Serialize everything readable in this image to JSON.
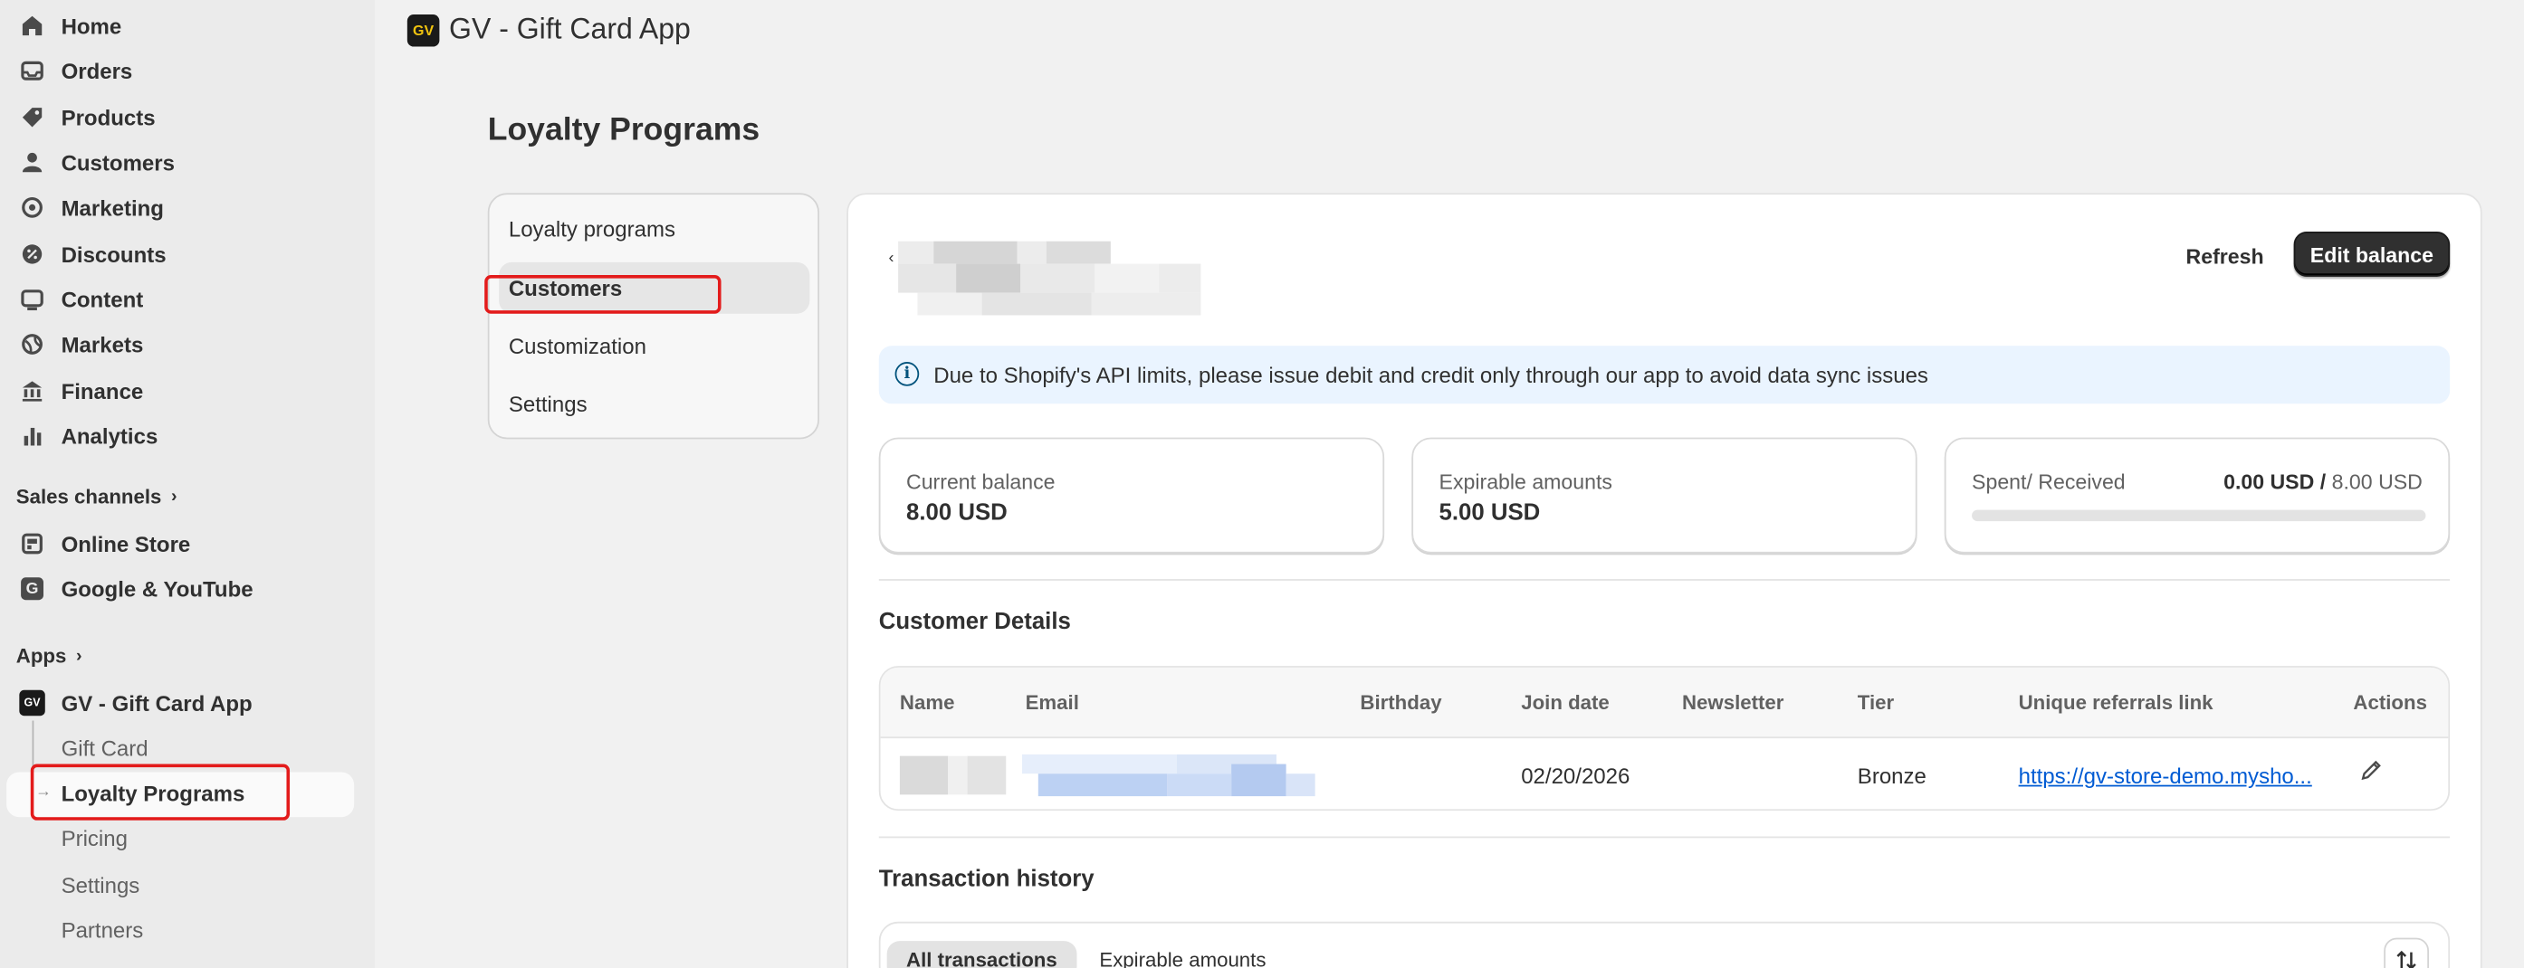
{
  "sidebar": {
    "items": [
      {
        "label": "Home",
        "icon": "home-icon"
      },
      {
        "label": "Orders",
        "icon": "inbox-icon"
      },
      {
        "label": "Products",
        "icon": "tag-icon"
      },
      {
        "label": "Customers",
        "icon": "person-icon"
      },
      {
        "label": "Marketing",
        "icon": "target-icon"
      },
      {
        "label": "Discounts",
        "icon": "discount-icon"
      },
      {
        "label": "Content",
        "icon": "content-icon"
      },
      {
        "label": "Markets",
        "icon": "globe-icon"
      },
      {
        "label": "Finance",
        "icon": "bank-icon"
      },
      {
        "label": "Analytics",
        "icon": "bar-chart-icon"
      }
    ],
    "sales_channels_label": "Sales channels",
    "channels": [
      {
        "label": "Online Store",
        "icon": "store-icon"
      },
      {
        "label": "Google & YouTube",
        "icon": "google-icon"
      }
    ],
    "apps_label": "Apps",
    "app": {
      "label": "GV - Gift Card App",
      "logo": "GV"
    },
    "app_subitems": [
      "Gift Card",
      "Loyalty Programs",
      "Pricing",
      "Settings",
      "Partners"
    ]
  },
  "header": {
    "app_title": "GV - Gift Card App",
    "logo_text": "GV"
  },
  "page": {
    "title": "Loyalty Programs"
  },
  "menu": {
    "items": [
      "Loyalty programs",
      "Customers",
      "Customization",
      "Settings"
    ],
    "selected": "Customers"
  },
  "actions": {
    "refresh": "Refresh",
    "edit_balance": "Edit balance"
  },
  "banner": {
    "text": "Due to Shopify's API limits, please issue debit and credit only through our app to avoid data sync issues",
    "icon": "info-icon"
  },
  "stats": {
    "current_balance": {
      "label": "Current balance",
      "value": "8.00 USD"
    },
    "expirable": {
      "label": "Expirable amounts",
      "value": "5.00 USD"
    },
    "spent_received": {
      "label": "Spent/ Received",
      "spent": "0.00 USD",
      "separator": "/",
      "received": "8.00 USD",
      "progress": 0
    }
  },
  "customer_details": {
    "title": "Customer Details",
    "columns": [
      "Name",
      "Email",
      "Birthday",
      "Join date",
      "Newsletter",
      "Tier",
      "Unique referrals link",
      "Actions"
    ],
    "row": {
      "birthday": "",
      "join_date": "02/20/2026",
      "newsletter": "",
      "tier": "Bronze",
      "referral_link": "https://gv-store-demo.mysho..."
    }
  },
  "transactions": {
    "title": "Transaction history",
    "tabs": [
      "All transactions",
      "Expirable amounts"
    ]
  },
  "colors": {
    "highlight": "#e31b1b",
    "primary_button": "#303030",
    "banner_bg": "#eaf4ff",
    "link": "#005bd3"
  }
}
